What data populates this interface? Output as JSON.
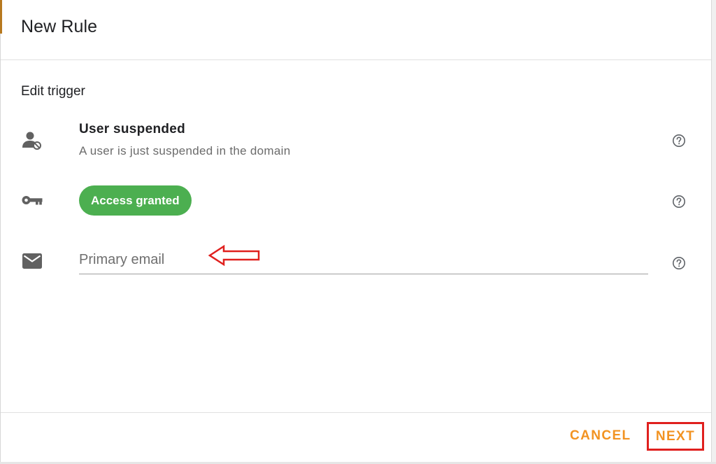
{
  "dialog": {
    "title": "New Rule"
  },
  "section": {
    "title": "Edit trigger"
  },
  "trigger": {
    "name": "User suspended",
    "description": "A user is just suspended in the domain",
    "icon": "user-blocked-icon"
  },
  "condition": {
    "chip_label": "Access granted",
    "chip_color": "#4caf50",
    "icon": "key-icon"
  },
  "email": {
    "placeholder": "Primary email",
    "value": "",
    "icon": "mail-icon"
  },
  "footer": {
    "cancel_label": "CANCEL",
    "next_label": "NEXT",
    "accent_color": "#f29322"
  },
  "annotation": {
    "color": "#e0201e"
  }
}
